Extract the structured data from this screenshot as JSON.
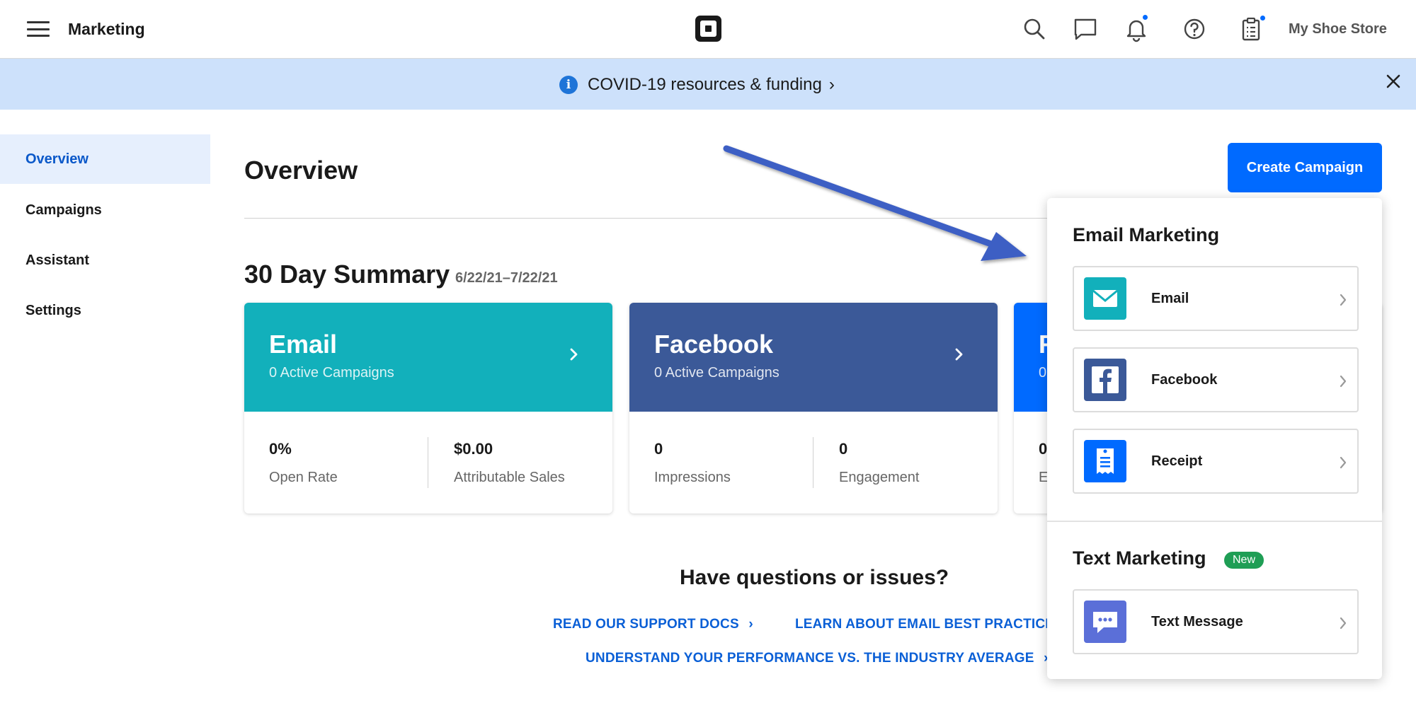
{
  "header": {
    "menu_icon": "hamburger-icon",
    "title": "Marketing",
    "logo": "square-logo",
    "store_name": "My Shoe Store",
    "icons": [
      "search-icon",
      "chat-icon",
      "bell-icon",
      "help-icon",
      "clipboard-icon"
    ]
  },
  "banner": {
    "text": "COVID-19 resources & funding",
    "chevron": "›",
    "icon": "info-icon",
    "close_icon": "close-icon"
  },
  "sidebar": {
    "items": [
      {
        "label": "Overview",
        "active": true
      },
      {
        "label": "Campaigns",
        "active": false
      },
      {
        "label": "Assistant",
        "active": false
      },
      {
        "label": "Settings",
        "active": false
      }
    ]
  },
  "main": {
    "title": "Overview",
    "create_button": "Create Campaign",
    "summary_title": "30 Day Summary",
    "summary_range": "6/22/21–7/22/21",
    "cards": [
      {
        "name": "Email",
        "subtitle": "0 Active Campaigns",
        "color": "#12b0bb",
        "metrics": [
          {
            "value": "0%",
            "label": "Open Rate"
          },
          {
            "value": "$0.00",
            "label": "Attributable Sales"
          }
        ]
      },
      {
        "name": "Facebook",
        "subtitle": "0 Active Campaigns",
        "color": "#3b5998",
        "metrics": [
          {
            "value": "0",
            "label": "Impressions"
          },
          {
            "value": "0",
            "label": "Engagement"
          }
        ]
      },
      {
        "name": "R",
        "subtitle": "0",
        "color": "#006aff",
        "metrics": [
          {
            "value": "0",
            "label": "E"
          }
        ]
      }
    ],
    "help": {
      "title": "Have questions or issues?",
      "links": [
        "READ OUR SUPPORT DOCS",
        "LEARN ABOUT EMAIL BEST PRACTICE",
        "UNDERSTAND YOUR PERFORMANCE VS. THE INDUSTRY AVERAGE"
      ],
      "link_chevron": "›"
    }
  },
  "dropdown": {
    "email_heading": "Email Marketing",
    "email_options": [
      {
        "label": "Email",
        "icon": "envelope-icon",
        "color": "#12b0bb"
      },
      {
        "label": "Facebook",
        "icon": "facebook-icon",
        "color": "#3b5998"
      },
      {
        "label": "Receipt",
        "icon": "receipt-icon",
        "color": "#006aff"
      }
    ],
    "text_heading": "Text Marketing",
    "text_badge": "New",
    "text_options": [
      {
        "label": "Text Message",
        "icon": "message-bubble-icon",
        "color": "#5b6fd8"
      }
    ]
  },
  "colors": {
    "accent": "#006aff",
    "banner_bg": "#cde1fb",
    "link": "#0a5fd6",
    "arrow": "#3d5fc4"
  }
}
